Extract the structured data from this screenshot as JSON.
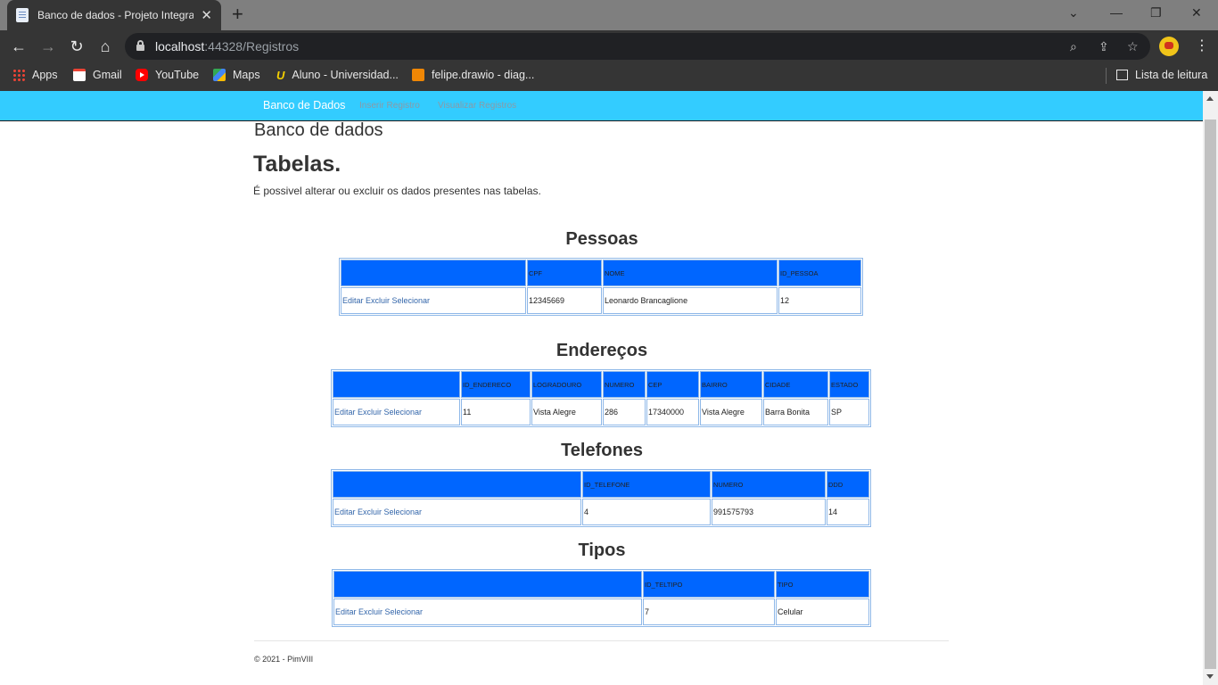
{
  "browser": {
    "tab_title": "Banco de dados - Projeto Integra",
    "url_host": "localhost",
    "url_rest": ":44328/Registros",
    "bookmarks": [
      "Apps",
      "Gmail",
      "YouTube",
      "Maps",
      "Aluno - Universidad...",
      "felipe.drawio - diag..."
    ],
    "reading_list": "Lista de leitura"
  },
  "nav": {
    "brand": "Banco de Dados",
    "links": [
      "Inserir Registro",
      "Visualizar Registros"
    ]
  },
  "header": {
    "subtitle": "Banco de dados",
    "title": "Tabelas.",
    "lead": "É possivel alterar ou excluir os dados presentes nas tabelas."
  },
  "row_actions": "Editar Excluir Selecionar",
  "tables": {
    "pessoas": {
      "title": "Pessoas",
      "columns": [
        "CPF",
        "NOME",
        "ID_PESSOA"
      ],
      "row": [
        "12345669",
        "Leonardo Brancaglione",
        "12"
      ]
    },
    "enderecos": {
      "title": "Endereços",
      "columns": [
        "ID_ENDERECO",
        "LOGRADOURO",
        "NUMERO",
        "CEP",
        "BAIRRO",
        "CIDADE",
        "ESTADO"
      ],
      "row": [
        "11",
        "Vista Alegre",
        "286",
        "17340000",
        "Vista Alegre",
        "Barra Bonita",
        "SP"
      ]
    },
    "telefones": {
      "title": "Telefones",
      "columns": [
        "ID_TELEFONE",
        "NUMERO",
        "DDD"
      ],
      "row": [
        "4",
        "991575793",
        "14"
      ]
    },
    "tipos": {
      "title": "Tipos",
      "columns": [
        "ID_TELTIPO",
        "TIPO"
      ],
      "row": [
        "7",
        "Celular"
      ]
    }
  },
  "footer": "© 2021 - PimVIII",
  "colors": {
    "navbar": "#33ccff",
    "table_header": "#0066ff",
    "link": "#3366aa"
  }
}
